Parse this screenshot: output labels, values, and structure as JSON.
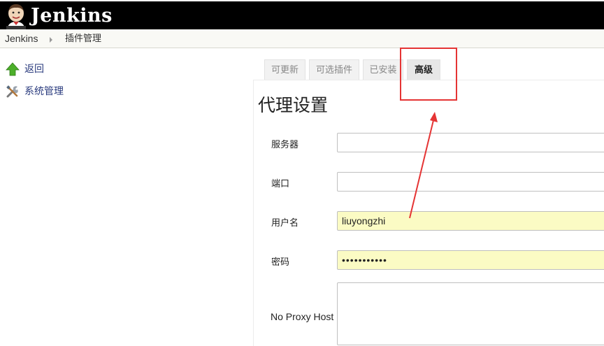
{
  "header": {
    "brand": "Jenkins",
    "logo_icon": "jenkins-butler-icon"
  },
  "breadcrumb": {
    "home": "Jenkins",
    "page": "插件管理"
  },
  "side_panel": {
    "items": [
      {
        "label": "返回",
        "icon": "up-arrow-icon"
      },
      {
        "label": "系统管理",
        "icon": "tools-icon"
      }
    ]
  },
  "tabs": [
    {
      "label": "可更新"
    },
    {
      "label": "可选插件"
    },
    {
      "label": "已安装"
    },
    {
      "label": "高级",
      "active": true
    }
  ],
  "section": {
    "title": "代理设置"
  },
  "form": {
    "server_label": "服务器",
    "server_value": "",
    "port_label": "端口",
    "port_value": "",
    "user_label": "用户名",
    "user_value": "liuyongzhi",
    "password_label": "密码",
    "password_value": "•••••••••••",
    "no_proxy_label": "No Proxy Host",
    "no_proxy_value": ""
  },
  "annotation": {
    "color": "#e53434"
  }
}
